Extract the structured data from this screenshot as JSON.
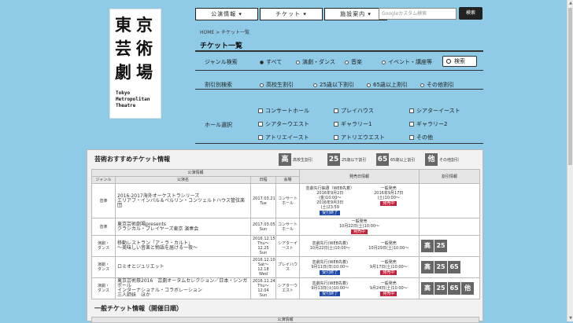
{
  "logo": {
    "kanji": [
      "東",
      "京",
      "芸",
      "術",
      "劇",
      "場"
    ],
    "english": "Tokyo\nMetropolitan\nTheatre"
  },
  "nav": {
    "items": [
      "公演情報 ▾",
      "チケット ▾",
      "施設案内 ▾"
    ]
  },
  "search": {
    "placeholder": "Googleカスタム検索",
    "button": "検索"
  },
  "breadcrumb": "HOME > チケット一覧",
  "page_title": "チケット一覧",
  "filters": {
    "genre": {
      "label": "ジャンル検索",
      "options": [
        "すべて",
        "演劇・ダンス",
        "音楽",
        "イベント・講座等"
      ],
      "selected": 0,
      "button": "検索"
    },
    "discount": {
      "label": "割引別検索",
      "options": [
        "高校生割引",
        "25歳以下割引",
        "65歳以上割引",
        "その他割引"
      ]
    },
    "hall": {
      "label": "ホール選択",
      "options": [
        "コンサートホール",
        "プレイハウス",
        "シアターイースト",
        "シアターウエスト",
        "ギャラリー1",
        "ギャラリー2",
        "アトリエイースト",
        "アトリエウエスト",
        "その他"
      ]
    }
  },
  "recommended": {
    "title": "芸術おすすめチケット情報",
    "legend": [
      {
        "badge": "高",
        "text": "高校生割引"
      },
      {
        "badge": "25",
        "text": "25歳以下割引"
      },
      {
        "badge": "65",
        "text": "65歳以上割引"
      },
      {
        "badge": "他",
        "text": "その他割引"
      }
    ],
    "headers": {
      "group": "公演情報",
      "genre": "ジャンル",
      "name": "公演名",
      "date": "日程",
      "venue": "会場",
      "sales": "発売日情報",
      "discount": "割引情報"
    },
    "rows": [
      {
        "genre": "音楽",
        "name": "2016-2017海外オーケストラシリーズ\nエリアフ・インバル＆ベルリン・コンツェルトハウス管弦楽団",
        "date": "2017.03.21\nTue",
        "venue": "コンサート\nホール",
        "sale1": "芸劇先行抽選（WEB先着）\n2016年9月2日\n(金)10:00～\n2016年9月3日\n(土)23:59",
        "sale1_btn": "受付終了",
        "sale2": "一般発売\n2016年9月17日\n(土)10:00～",
        "sale2_btn": "発売中",
        "discount": []
      },
      {
        "genre": "音楽",
        "name": "東京芸術劇場presents\nクラシカル・プレイヤーズ東京 演奏会",
        "date": "2017.03.05\nSun",
        "venue": "コンサート\nホール",
        "sale1": "一般発売\n10月22日(土)10:00～",
        "sale1_btn": "発売中",
        "sale2": "",
        "sale2_btn": "",
        "discount": []
      },
      {
        "genre": "演劇・\nダンス",
        "name": "移動レストラン「ア・ラ・カルト」\n～美味しい音楽と物語を届ける一夜～",
        "date": "2016.12.15\nThu～\n12.25\nSun",
        "venue": "シアターイ\nースト",
        "sale1": "芸劇先行(WEB先着)\n10月22日(土)10:00～",
        "sale1_btn": "",
        "sale2": "一般発売\n10月29日(土)10:00～",
        "sale2_btn": "",
        "discount": [
          "高",
          "25"
        ]
      },
      {
        "genre": "演劇・\nダンス",
        "name": "ロミオとジュリエット",
        "date": "2016.12.10\nSat～12.18\nWed",
        "venue": "プレイハウ\nス",
        "sale1": "芸劇先行(WEB先着)\n9月11日(日)10:00～",
        "sale1_btn": "受付終了",
        "sale2": "一般発売\n9月17日(土)10:00～",
        "sale2_btn": "発売中",
        "discount": [
          "高",
          "25",
          "65"
        ]
      },
      {
        "genre": "演劇・\nダンス",
        "name": "東京芸術祭2016　芸劇オータムセレクション／日本・シンガポール\nインターナショナル・コラボレーション\n三人姉妹　ほか",
        "date": "2016.11.24\nThu～12.04\nSun",
        "venue": "シアターウ\nエスト",
        "sale1": "芸劇先行(WEB先着)\n9月13日(火)10:00～",
        "sale1_btn": "受付終了",
        "sale2": "一般発売\n9月24日(土)10:00～",
        "sale2_btn": "発売中",
        "discount": [
          "高",
          "25",
          "65",
          "他"
        ]
      }
    ]
  },
  "general": {
    "title": "一般チケット情報（開催日順）",
    "header": "公演情報"
  }
}
